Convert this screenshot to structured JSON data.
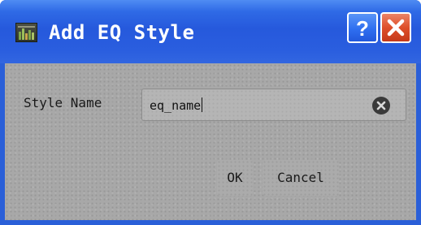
{
  "window": {
    "title": "Add EQ Style",
    "app_icon": "equalizer-icon",
    "help_button": "?",
    "close_icon": "close-icon"
  },
  "form": {
    "style_name_label": "Style Name",
    "style_name_value": "eq_name",
    "clear_icon": "clear-text-icon"
  },
  "buttons": {
    "ok_label": "OK",
    "cancel_label": "Cancel"
  },
  "colors": {
    "titlebar": "#2a5edf",
    "close_button": "#de4f2a",
    "client_background": "#a8a8a8"
  }
}
